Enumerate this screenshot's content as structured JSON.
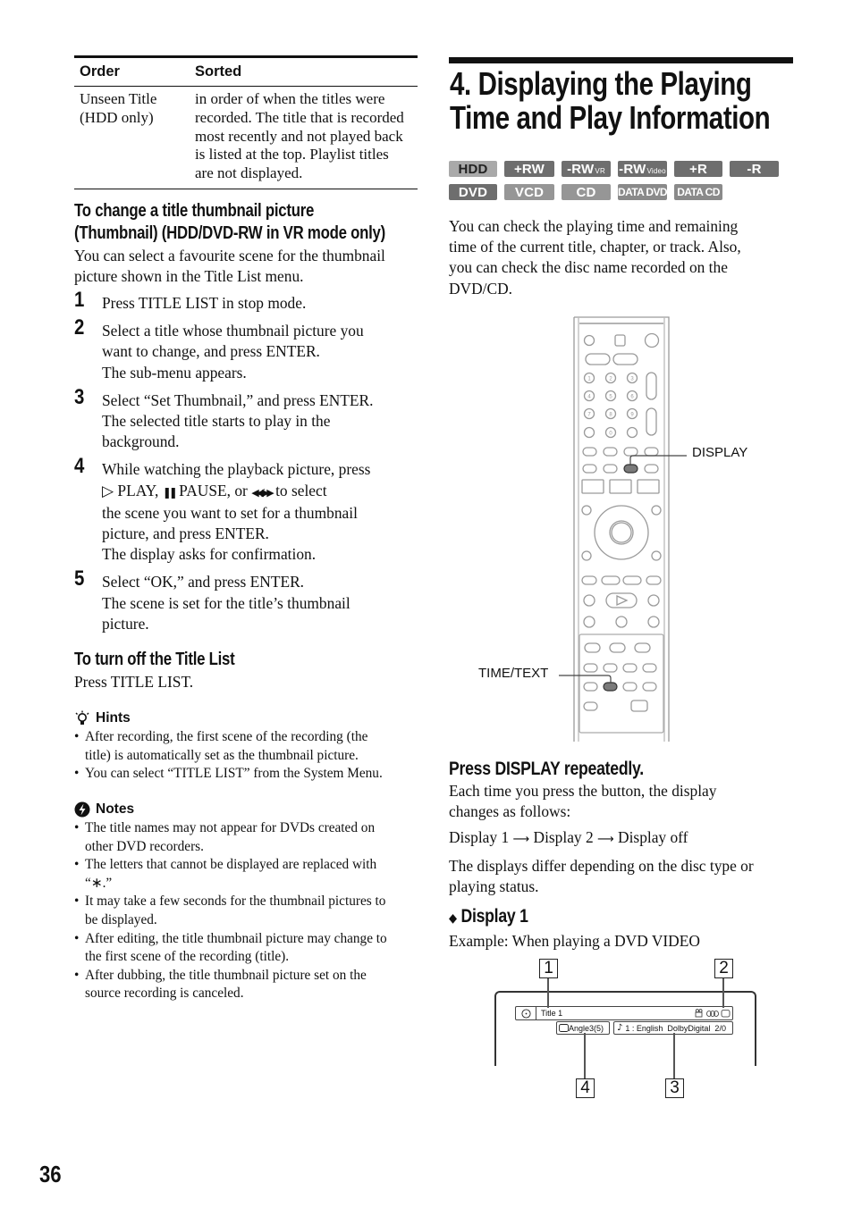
{
  "page_number": "36",
  "sort_table": {
    "headers": [
      "Order",
      "Sorted"
    ],
    "rows": [
      {
        "order": [
          "Unseen Title",
          "(HDD only)"
        ],
        "sorted": [
          "in order of when the titles were",
          "recorded. The title that is recorded",
          "most recently and not played back",
          "is listed at the top. Playlist titles",
          "are not displayed."
        ]
      }
    ]
  },
  "thumbnail_section": {
    "heading_lines": [
      "To change a title thumbnail picture",
      "(Thumbnail) (HDD/DVD-RW in VR mode only)"
    ],
    "intro_lines": [
      "You can select a favourite scene for the thumbnail",
      "picture shown in the Title List menu."
    ],
    "steps": [
      {
        "num": "1",
        "lines": [
          "Press TITLE LIST in stop mode."
        ]
      },
      {
        "num": "2",
        "lines": [
          "Select a title whose thumbnail picture you",
          "want to change, and press ENTER.",
          "The sub-menu appears."
        ]
      },
      {
        "num": "3",
        "lines": [
          "Select “Set Thumbnail,” and press ENTER.",
          "The selected title starts to play in the",
          "background."
        ]
      },
      {
        "num": "4",
        "lines_special": {
          "play_icon": "▷",
          "l1": "While watching the playback picture, press",
          "l2_play": " PLAY, ",
          "l2_pause_icon": "❚❚",
          "l2_pause": " PAUSE, or ",
          "l2_scan_icon": "◀◀/▶▶",
          "l2_tail": " to select",
          "l3": "the scene you want to set for a thumbnail",
          "l4": "picture, and press ENTER.",
          "l5": "The display asks for confirmation."
        }
      },
      {
        "num": "5",
        "lines": [
          "Select “OK,” and press ENTER.",
          "The scene is set for the title’s thumbnail",
          "picture."
        ]
      }
    ]
  },
  "turn_off_section": {
    "heading": "To turn off the Title List",
    "text": "Press TITLE LIST."
  },
  "hints": {
    "icon": "lightbulb-icon",
    "title": "Hints",
    "items": [
      [
        "After recording, the first scene of the recording (the",
        "title) is automatically set as the thumbnail picture."
      ],
      [
        "You can select “TITLE LIST” from the System Menu."
      ]
    ]
  },
  "notes": {
    "icon": "notes-icon",
    "title": "Notes",
    "items": [
      [
        "The title names may not appear for DVDs created on",
        "other DVD recorders."
      ],
      [
        "The letters that cannot be displayed are replaced with",
        "“∗.”"
      ],
      [
        "It may take a few seconds for the thumbnail pictures to",
        "be displayed."
      ],
      [
        "After editing, the title thumbnail picture may change to",
        "the first scene of the recording (title)."
      ],
      [
        "After dubbing, the title thumbnail picture set on the",
        "source recording is canceled."
      ]
    ]
  },
  "main": {
    "title_lines": [
      "4. Displaying the Playing",
      "Time and Play Information"
    ],
    "badges_row1": [
      {
        "label": "HDD",
        "sub": "",
        "color": "#a9a9a9",
        "text_color": "#222222"
      },
      {
        "label": "+RW",
        "sub": "",
        "color": "#6e6e6e",
        "text_color": "#ffffff"
      },
      {
        "label": "-RW",
        "sub": "VR",
        "color": "#6e6e6e",
        "text_color": "#ffffff"
      },
      {
        "label": "-RW",
        "sub": "Video",
        "color": "#6e6e6e",
        "text_color": "#ffffff"
      },
      {
        "label": "+R",
        "sub": "",
        "color": "#6e6e6e",
        "text_color": "#ffffff"
      },
      {
        "label": "-R",
        "sub": "",
        "color": "#6e6e6e",
        "text_color": "#ffffff"
      }
    ],
    "badges_row2": [
      {
        "label": "DVD",
        "color": "#6e6e6e",
        "text_color": "#ffffff"
      },
      {
        "label": "VCD",
        "color": "#969696",
        "text_color": "#ffffff"
      },
      {
        "label": "CD",
        "color": "#969696",
        "text_color": "#ffffff"
      },
      {
        "label": "DATA DVD",
        "color": "#8a8a8a",
        "text_color": "#ffffff"
      },
      {
        "label": "DATA CD",
        "color": "#8a8a8a",
        "text_color": "#ffffff"
      }
    ],
    "intro_lines": [
      "You can check the playing time and remaining",
      "time of the current title, chapter, or track. Also,",
      "you can check the disc name recorded on the",
      "DVD/CD."
    ],
    "remote_callouts": {
      "display": "DISPLAY",
      "time_text": "TIME/TEXT"
    },
    "remote_labels": {
      "numbers": [
        "1",
        "2",
        "3",
        "4",
        "5",
        "6",
        "7",
        "8",
        "9",
        "0"
      ]
    },
    "instruction_heading": "Press DISPLAY repeatedly.",
    "instruction_lines": [
      "Each time you press the button, the display",
      "changes as follows:"
    ],
    "sequence": {
      "a": "Display 1",
      "b": "Display 2",
      "c": "Display off",
      "arrow": "⟶"
    },
    "differ_lines": [
      "The displays differ depending on the disc type or",
      "playing status."
    ],
    "display1_heading": "Display 1",
    "display1_bullet": "◆",
    "example": "Example: When playing a DVD VIDEO",
    "osd": {
      "title": "Title 1",
      "angle": "Angle3(5)",
      "audio": "1 : English  DolbyDigital  2/0",
      "note_icon": "♪",
      "callout_numbers": [
        "1",
        "2",
        "3",
        "4"
      ]
    }
  }
}
